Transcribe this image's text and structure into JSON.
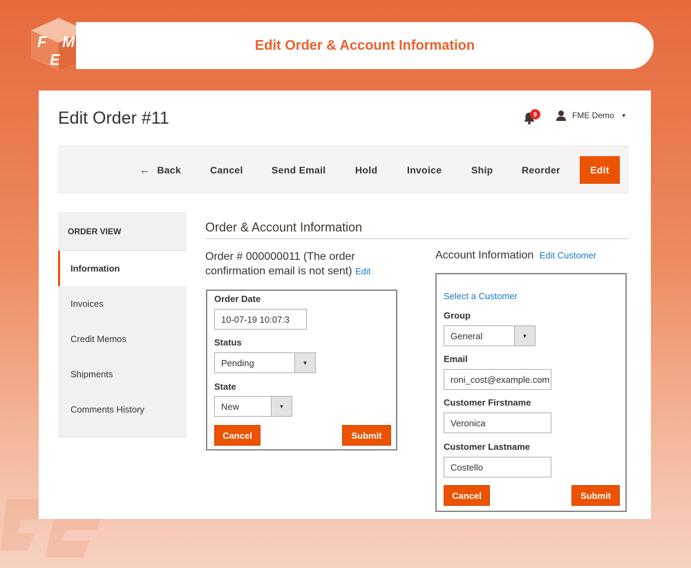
{
  "banner": {
    "title": "Edit Order & Account Information"
  },
  "logo": {
    "text": "FME",
    "name": "fme-logo"
  },
  "header": {
    "page_title": "Edit Order #11",
    "notifications_count": "9",
    "user_name": "FME Demo"
  },
  "toolbar": {
    "back": "Back",
    "cancel": "Cancel",
    "send_email": "Send Email",
    "hold": "Hold",
    "invoice": "Invoice",
    "ship": "Ship",
    "reorder": "Reorder",
    "edit": "Edit"
  },
  "sidebar": {
    "heading": "ORDER VIEW",
    "items": [
      {
        "label": "Information",
        "active": true
      },
      {
        "label": "Invoices"
      },
      {
        "label": "Credit Memos"
      },
      {
        "label": "Shipments"
      },
      {
        "label": "Comments History"
      }
    ]
  },
  "main": {
    "section_title": "Order & Account Information",
    "order": {
      "heading_line1": "Order # 000000011 (The order",
      "heading_line2": "confirmation email is not sent)",
      "edit_link": "Edit",
      "order_date_label": "Order Date",
      "order_date_value": "10-07-19 10:07:3",
      "status_label": "Status",
      "status_value": "Pending",
      "state_label": "State",
      "state_value": "New",
      "cancel": "Cancel",
      "submit": "Submit"
    },
    "account": {
      "heading": "Account Information",
      "edit_customer_link": "Edit Customer",
      "select_customer_link": "Select a Customer",
      "group_label": "Group",
      "group_value": "General",
      "email_label": "Email",
      "email_value": "roni_cost@example.com",
      "firstname_label": "Customer Firstname",
      "firstname_value": "Veronica",
      "lastname_label": "Customer Lastname",
      "lastname_value": "Costello",
      "cancel": "Cancel",
      "submit": "Submit"
    }
  },
  "colors": {
    "accent": "#eb5202",
    "link": "#1979c3",
    "banner_text": "#e8622d"
  }
}
